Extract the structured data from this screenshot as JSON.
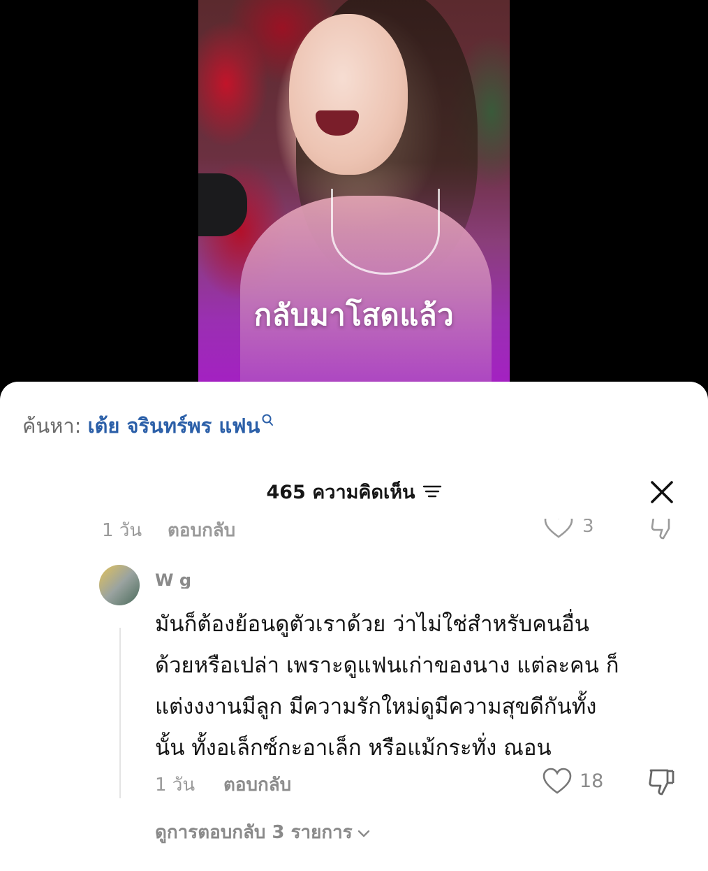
{
  "video": {
    "caption": "กลับมาโสดแล้ว"
  },
  "search": {
    "prefix": "ค้นหา:",
    "query": "เต้ย จรินทร์พร แฟน",
    "icon": "search-icon"
  },
  "comments_header": {
    "title": "465 ความคิดเห็น",
    "filter_icon": "filter-icon",
    "close_icon": "close-icon"
  },
  "previous_comment": {
    "time": "1 วัน",
    "reply_label": "ตอบกลับ",
    "likes": "3"
  },
  "comment": {
    "username": "W                  g",
    "lines": [
      "มันก็ต้องย้อนดูตัวเราด้วย ว่าไม่ใช่สำหรับคนอื่น",
      "ด้วยหรือเปล่า เพราะดูแฟนเก่าของนาง แต่ละคน ก็",
      "แต่งงงานมีลูก มีความรักใหม่ดูมีความสุขดีกันทั้ง",
      "นั้น ทั้งอเล็กซ์กะอาเล็ก หรือแม้กระทั่ง ณอน"
    ],
    "time": "1 วัน",
    "reply_label": "ตอบกลับ",
    "likes": "18",
    "view_replies": "ดูการตอบกลับ 3 รายการ"
  },
  "colors": {
    "search_query": "#2b5fa8",
    "caption_gradient_end": "#a51fc4",
    "muted_text": "#9a9a9a"
  }
}
